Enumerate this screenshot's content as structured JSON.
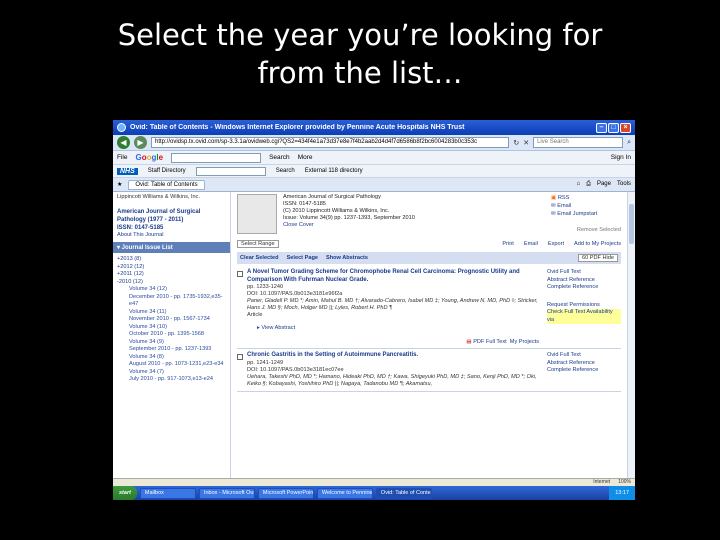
{
  "slide": {
    "title_line1": "Select the year you’re looking for",
    "title_line2": "from the list…"
  },
  "browser": {
    "window_title": "Ovid: Table of Contents - Windows Internet Explorer provided by Pennine Acute Hospitals NHS Trust",
    "address": "http://ovidsp.tx.ovid.com/sp-3.3.1a/ovidweb.cgi?QS2=434f4e1a73d37e8e7f4b2aab2d4d4f7d6586b8f2bc6004283b0c353c",
    "live_search_placeholder": "Live Search",
    "menu_file": "File",
    "google_letters": [
      "G",
      "o",
      "o",
      "g",
      "l",
      "e"
    ],
    "search_btn": "Search",
    "more_btn": "More",
    "sign_in": "Sign In",
    "nhs_logo": "NHS",
    "staff_directory": "Staff Directory",
    "nhs_search": "Search",
    "external_directory": "External 118 directory",
    "tab_label": "Ovid: Table of Contents",
    "page_menu": "Page",
    "tools_menu": "Tools"
  },
  "sidebar": {
    "publisher": "Lippincott Williams & Wilkins, Inc.",
    "journal_name": "American Journal of Surgical Pathology (1977 - 2011)",
    "issn": "ISSN: 0147-5185",
    "about": "About This Journal",
    "issue_list_header": "▾ Journal Issue List",
    "years": [
      "+2013 (8)",
      "+2012 (12)",
      "+2011 (12)",
      "-2010 (12)"
    ],
    "volumes": [
      "Volume 34 (12)",
      "December 2010 - pp. 1735-1932,e35-e47",
      "Volume 34 (11)",
      "November 2010 - pp. 1567-1734",
      "Volume 34 (10)",
      "October 2010 - pp. 1395-1568",
      "Volume 34 (9)",
      "September 2010 - pp. 1237-1393",
      "Volume 34 (8)",
      "August 2010 - pp. 1073-1231,e23-e34",
      "Volume 34 (7)",
      "July 2010 - pp. 917-1073,e13-e24"
    ]
  },
  "journal": {
    "title": "American Journal of Surgical Pathology",
    "issn": "ISSN: 0147-5185",
    "copyright": "(C) 2010 Lippincott Williams & Wilkins, Inc.",
    "issue": "Issue: Volume 34(9) pp. 1237-1393, September 2010",
    "close_cover": "Close Cover",
    "rss": "RSS",
    "email": "Email",
    "email_jumpstart": "Email Jumpstart",
    "kbase_label": "Remove Selected"
  },
  "toolbar": {
    "select_range": "Select Range",
    "print": "Print",
    "email": "Email",
    "export": "Export",
    "add_projects": "Add to My Projects",
    "clear_selected": "Clear Selected",
    "select_page": "Select Page",
    "show_abstracts": "Show Abstracts",
    "pdf_select": "60  PDF Hide"
  },
  "articles": [
    {
      "title": "A Novel Tumor Grading Scheme for Chromophobe Renal Cell Carcinoma: Prognostic Utility and Comparison With Fuhrman Nuclear Grade.",
      "pages": "pp. 1233-1240",
      "doi": "DOI: 10.1097/PAS.0b013e3181e96f2a",
      "authors": "Paner, Gladell P. MD *; Amin, Mahul B. MD †; Alvarado-Cabrero, Isabel MD ‡; Young, Andrew N. MD, PhD ◊; Stricker, Hans J. MD §; Moch, Holger MD ||; Lyles, Robert H. PhD ¶",
      "type": "Article",
      "view_abstract": "▸ View Abstract",
      "pdf": "PDF Full Text",
      "my_projects": "My Projects",
      "links": [
        "Ovid Full Text",
        "Abstract Reference",
        "Complete Reference",
        "Request Permissions",
        "Check Full Text Availability via"
      ]
    },
    {
      "title": "Chronic Gastritis in the Setting of Autoimmune Pancreatitis.",
      "pages": "pp. 1241-1249",
      "doi": "DOI: 10.1097/PAS.0b013e3181ec07ee",
      "authors": "Uehara, Takeshi PhD, MD *; Hamano, Hideaki PhD, MD †; Kawa, Shigeyuki PhD, MD ‡; Sano, Kenji PhD, MD *; Oki, Keiko §; Kobayashi, Yoshihiro PhD ||; Nagaya, Tadanobu MD ¶; Akamatsu,",
      "links": [
        "Ovid Full Text",
        "Abstract Reference",
        "Complete Reference"
      ]
    }
  ],
  "status": {
    "zone": "Internet",
    "zoom": "100%"
  },
  "taskbar": {
    "start": "start",
    "items": [
      "Mailbox",
      "Inbox - Microsoft Out...",
      "Microsoft PowerPoint...",
      "Welcome to Pennine...",
      "Ovid: Table of Conte..."
    ],
    "clock": "13:17"
  }
}
